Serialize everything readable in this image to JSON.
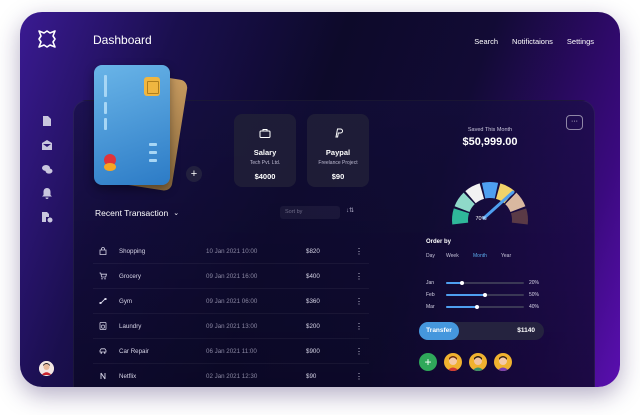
{
  "app": {
    "title": "Dashboard"
  },
  "topnav": [
    "Search",
    "Notifictaions",
    "Settings"
  ],
  "sidebar_icons": [
    "document-icon",
    "mail-icon",
    "chat-icon",
    "bell-icon",
    "settings-file-icon"
  ],
  "accounts": [
    {
      "name": "Salary",
      "subtitle": "Tech Pvt. Ltd.",
      "amount": "$4000",
      "icon": "briefcase-icon",
      "color": "#c7935a"
    },
    {
      "name": "Paypal",
      "subtitle": "Freelance Project",
      "amount": "$90",
      "icon": "paypal-icon",
      "color": "#2f8ed0"
    }
  ],
  "recent": {
    "title": "Recent Transaction",
    "sort_placeholder": "Sort by"
  },
  "transactions": [
    {
      "name": "Shopping",
      "date": "10 Jan 2021 10:00",
      "amount": "$820",
      "icon": "bag-icon"
    },
    {
      "name": "Grocery",
      "date": "09 Jan 2021 16:00",
      "amount": "$400",
      "icon": "cart-icon"
    },
    {
      "name": "Gym",
      "date": "09 Jan 2021 06:00",
      "amount": "$360",
      "icon": "dumbbell-icon"
    },
    {
      "name": "Laundry",
      "date": "09 Jan 2021 13:00",
      "amount": "$200",
      "icon": "washer-icon"
    },
    {
      "name": "Car Repair",
      "date": "06 Jan 2021 11:00",
      "amount": "$900",
      "icon": "car-icon"
    },
    {
      "name": "Netflix",
      "date": "02 Jan 2021 12:30",
      "amount": "$90",
      "icon": "netflix-icon"
    }
  ],
  "saved": {
    "label": "Saved This Month",
    "amount": "$50,999.00",
    "percent_label": "70%",
    "percent": 70
  },
  "order": {
    "title": "Order by",
    "tabs": [
      "Day",
      "Week",
      "Month",
      "Year"
    ],
    "active_tab": "Month",
    "bars": [
      {
        "label": "Jan",
        "value": 20,
        "pct_label": "20%"
      },
      {
        "label": "Feb",
        "value": 50,
        "pct_label": "50%"
      },
      {
        "label": "Mar",
        "value": 40,
        "pct_label": "40%"
      }
    ]
  },
  "transfer": {
    "label": "Transfer",
    "amount": "$1140"
  },
  "colors": {
    "accent": "#4597dd",
    "green": "#2fa85a",
    "bg_left": "#3a1a92",
    "bg_right": "#5a0fb0"
  }
}
